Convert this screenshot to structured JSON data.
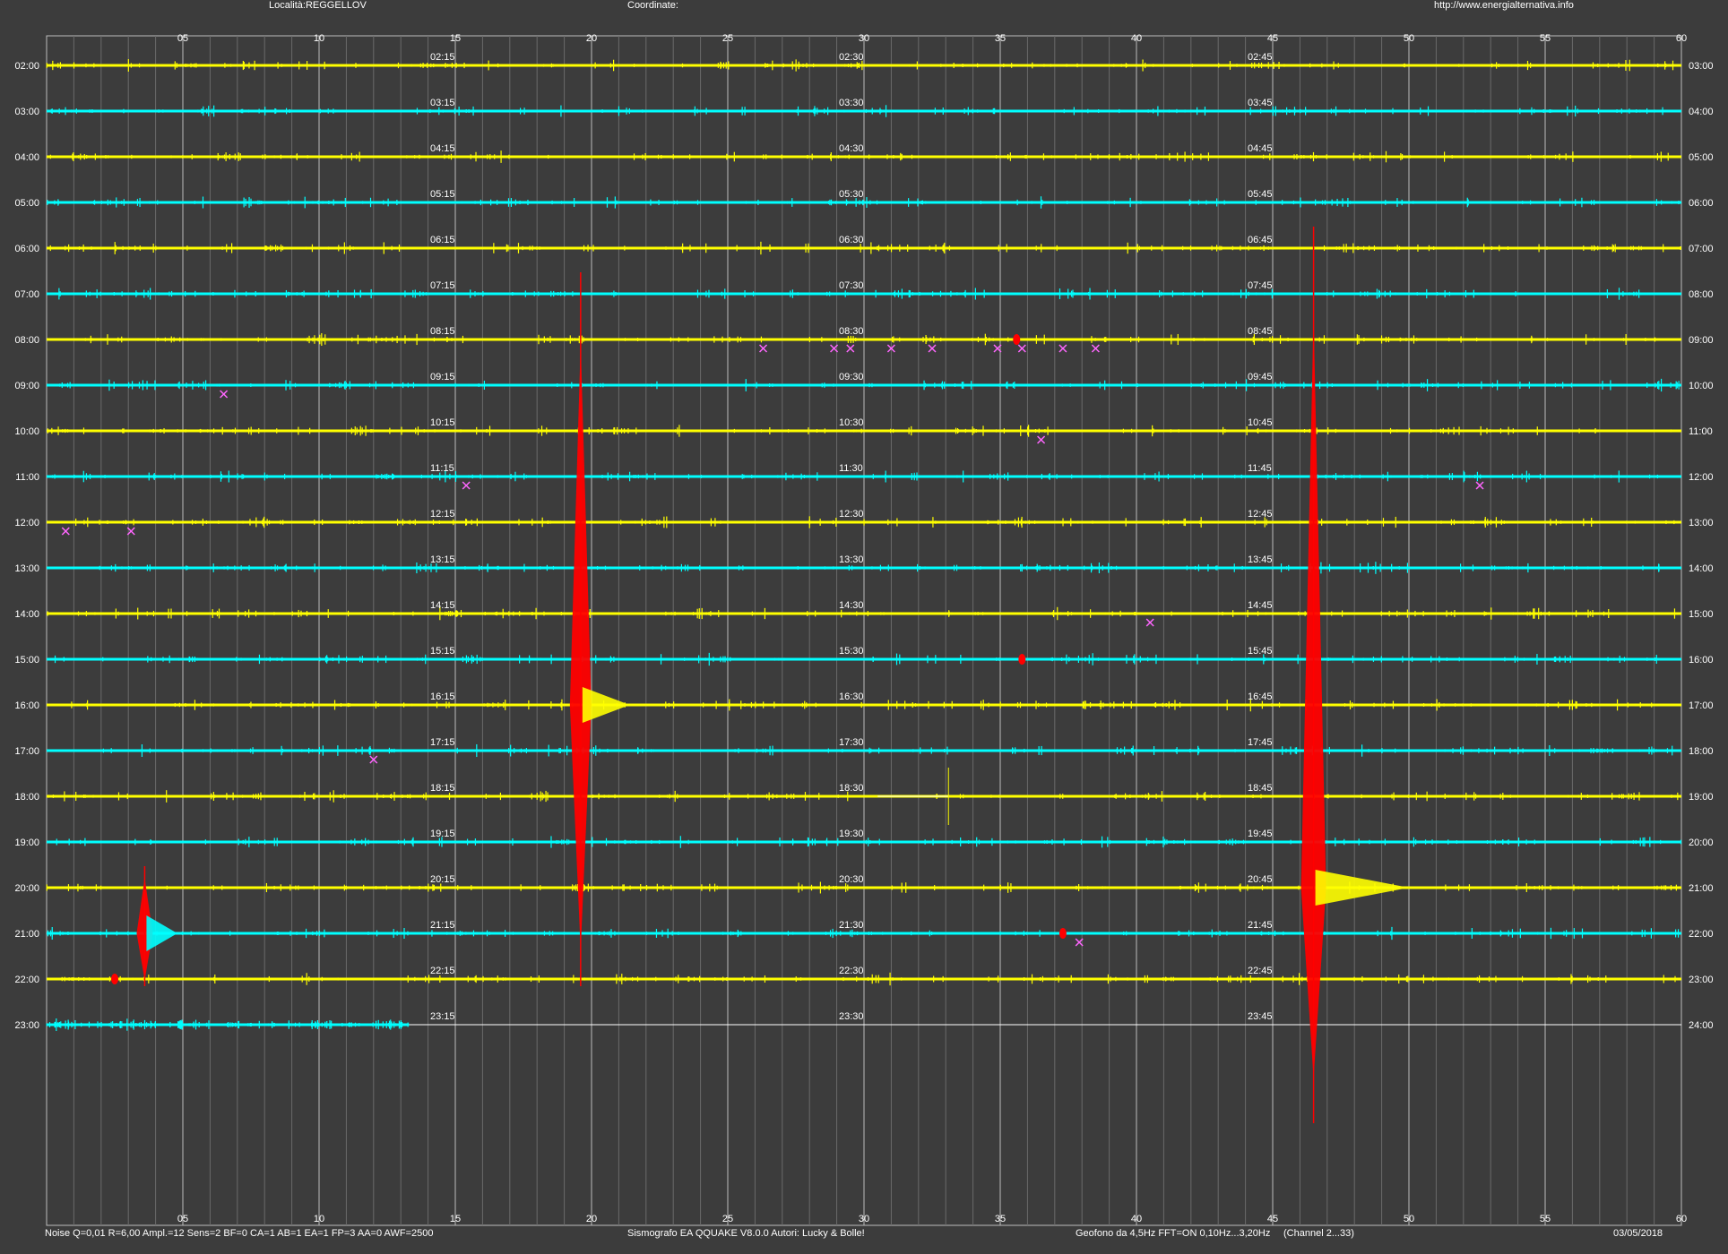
{
  "header": {
    "location": "Località:REGGELLOV",
    "coordinates": "Coordinate:",
    "url": "http://www.energialternativa.info"
  },
  "footer": {
    "params": "Noise Q=0,01 R=6,00 Ampl.=12 Sens=2 BF=0 CA=1 AB=1 EA=1 FP=3 AA=0 AWF=2500",
    "software": "Sismografo EA QQUAKE  V8.0.0  Autori: Lucky & Bolle!",
    "geofono": "Geofono da 4,5Hz FFT=ON 0,10Hz...3,20Hz",
    "channel": "(Channel 2...33)",
    "date": "03/05/2018"
  },
  "colors": {
    "background": "#3c3c3c",
    "grid": "#bdbdbd",
    "trace_yellow": "#ffff00",
    "trace_cyan": "#00ffff",
    "event_red": "#ff0000",
    "marker": "#ff66ff"
  },
  "chart_data": {
    "type": "seismogram",
    "x_ticks": [
      "05",
      "10",
      "15",
      "20",
      "25",
      "30",
      "35",
      "40",
      "45",
      "50",
      "55",
      "60"
    ],
    "xlim": [
      0,
      60
    ],
    "rows": [
      {
        "left": "02:00",
        "right": "03:00",
        "mid": [
          "02:15",
          "02:30",
          "02:45"
        ],
        "color": "yellow"
      },
      {
        "left": "03:00",
        "right": "04:00",
        "mid": [
          "03:15",
          "03:30",
          "03:45"
        ],
        "color": "cyan"
      },
      {
        "left": "04:00",
        "right": "05:00",
        "mid": [
          "04:15",
          "04:30",
          "04:45"
        ],
        "color": "yellow"
      },
      {
        "left": "05:00",
        "right": "06:00",
        "mid": [
          "05:15",
          "05:30",
          "05:45"
        ],
        "color": "cyan"
      },
      {
        "left": "06:00",
        "right": "07:00",
        "mid": [
          "06:15",
          "06:30",
          "06:45"
        ],
        "color": "yellow"
      },
      {
        "left": "07:00",
        "right": "08:00",
        "mid": [
          "07:15",
          "07:30",
          "07:45"
        ],
        "color": "cyan"
      },
      {
        "left": "08:00",
        "right": "09:00",
        "mid": [
          "08:15",
          "08:30",
          "08:45"
        ],
        "color": "yellow"
      },
      {
        "left": "09:00",
        "right": "10:00",
        "mid": [
          "09:15",
          "09:30",
          "09:45"
        ],
        "color": "cyan"
      },
      {
        "left": "10:00",
        "right": "11:00",
        "mid": [
          "10:15",
          "10:30",
          "10:45"
        ],
        "color": "yellow"
      },
      {
        "left": "11:00",
        "right": "12:00",
        "mid": [
          "11:15",
          "11:30",
          "11:45"
        ],
        "color": "cyan"
      },
      {
        "left": "12:00",
        "right": "13:00",
        "mid": [
          "12:15",
          "12:30",
          "12:45"
        ],
        "color": "yellow"
      },
      {
        "left": "13:00",
        "right": "14:00",
        "mid": [
          "13:15",
          "13:30",
          "13:45"
        ],
        "color": "cyan"
      },
      {
        "left": "14:00",
        "right": "15:00",
        "mid": [
          "14:15",
          "14:30",
          "14:45"
        ],
        "color": "yellow"
      },
      {
        "left": "15:00",
        "right": "16:00",
        "mid": [
          "15:15",
          "15:30",
          "15:45"
        ],
        "color": "cyan"
      },
      {
        "left": "16:00",
        "right": "17:00",
        "mid": [
          "16:15",
          "16:30",
          "16:45"
        ],
        "color": "yellow"
      },
      {
        "left": "17:00",
        "right": "18:00",
        "mid": [
          "17:15",
          "17:30",
          "17:45"
        ],
        "color": "cyan"
      },
      {
        "left": "18:00",
        "right": "19:00",
        "mid": [
          "18:15",
          "18:30",
          "18:45"
        ],
        "color": "yellow"
      },
      {
        "left": "19:00",
        "right": "20:00",
        "mid": [
          "19:15",
          "19:30",
          "19:45"
        ],
        "color": "cyan"
      },
      {
        "left": "20:00",
        "right": "21:00",
        "mid": [
          "20:15",
          "20:30",
          "20:45"
        ],
        "color": "yellow"
      },
      {
        "left": "21:00",
        "right": "22:00",
        "mid": [
          "21:15",
          "21:30",
          "21:45"
        ],
        "color": "cyan"
      },
      {
        "left": "22:00",
        "right": "23:00",
        "mid": [
          "22:15",
          "22:30",
          "22:45"
        ],
        "color": "yellow"
      },
      {
        "left": "23:00",
        "right": "24:00",
        "mid": [
          "23:15",
          "23:30",
          "23:45"
        ],
        "color": "cyan",
        "data_end_min": 13.3
      }
    ],
    "events": [
      {
        "row": 0,
        "minute": 19.6,
        "row_span": [
          5,
          20
        ],
        "peak_row": 14,
        "color": "red",
        "coda_color": "yellow",
        "coda_minutes": 1.8
      },
      {
        "row": 0,
        "minute": 46.5,
        "row_span": [
          4,
          23
        ],
        "peak_row": 18,
        "color": "red",
        "coda_color": "yellow",
        "coda_minutes": 3.5
      },
      {
        "row": 19,
        "minute": 3.6,
        "row_span": [
          18,
          20
        ],
        "peak_row": 19,
        "color": "red",
        "coda_color": "cyan",
        "coda_minutes": 1.2
      }
    ],
    "small_red": [
      {
        "row": 6,
        "minute": 35.6
      },
      {
        "row": 13,
        "minute": 35.8
      },
      {
        "row": 19,
        "minute": 37.3
      },
      {
        "row": 20,
        "minute": 2.5
      }
    ],
    "markers": [
      {
        "row": 6,
        "minute": 26.3
      },
      {
        "row": 6,
        "minute": 28.9
      },
      {
        "row": 6,
        "minute": 29.5
      },
      {
        "row": 6,
        "minute": 31.0
      },
      {
        "row": 6,
        "minute": 32.5
      },
      {
        "row": 6,
        "minute": 34.9
      },
      {
        "row": 6,
        "minute": 35.8
      },
      {
        "row": 6,
        "minute": 37.3
      },
      {
        "row": 6,
        "minute": 38.5
      },
      {
        "row": 7,
        "minute": 6.5
      },
      {
        "row": 8,
        "minute": 36.5
      },
      {
        "row": 9,
        "minute": 15.4
      },
      {
        "row": 9,
        "minute": 52.6
      },
      {
        "row": 10,
        "minute": 0.7
      },
      {
        "row": 10,
        "minute": 3.1
      },
      {
        "row": 12,
        "minute": 40.5
      },
      {
        "row": 15,
        "minute": 12.0
      },
      {
        "row": 19,
        "minute": 37.9
      }
    ],
    "glitch": {
      "row": 16,
      "start_minute": 30.5,
      "end_minute": 33.1
    }
  }
}
